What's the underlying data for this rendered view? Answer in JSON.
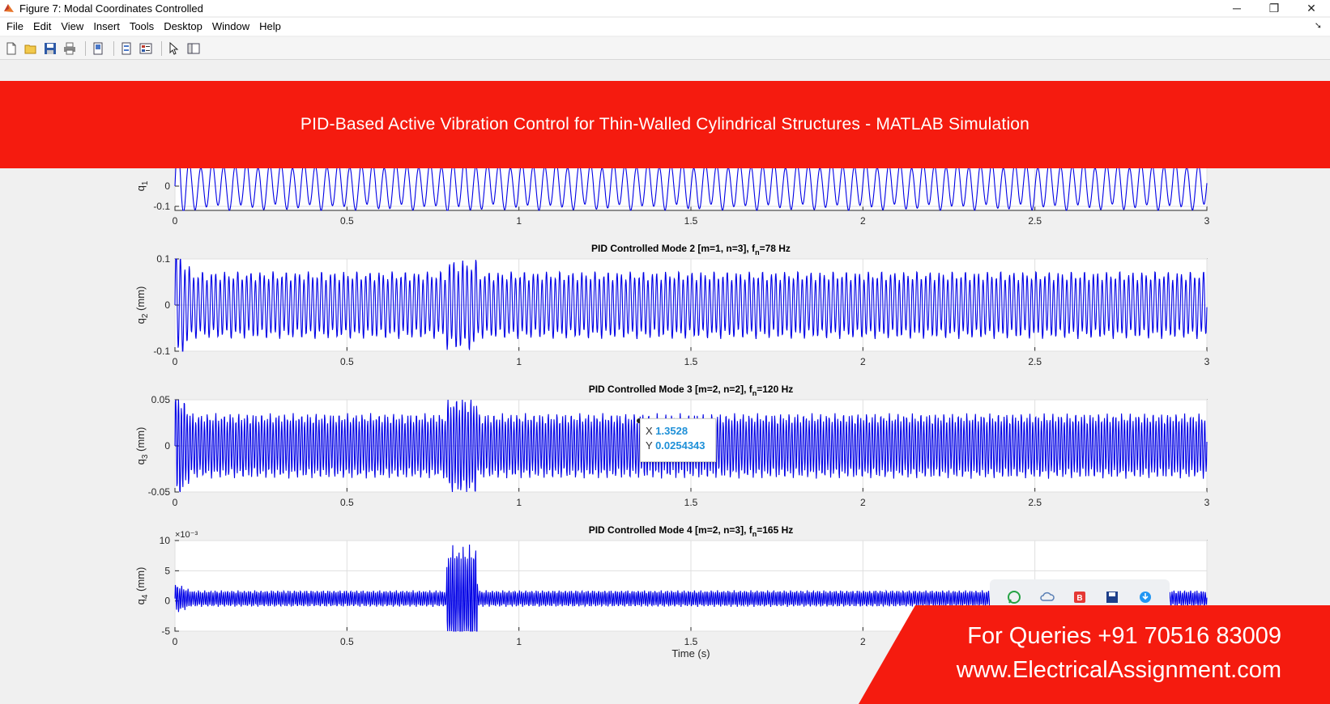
{
  "window": {
    "title": "Figure 7: Modal Coordinates Controlled"
  },
  "menu": {
    "items": [
      "File",
      "Edit",
      "View",
      "Insert",
      "Tools",
      "Desktop",
      "Window",
      "Help"
    ]
  },
  "toolbar": {
    "buttons": [
      "new-figure-icon",
      "open-file-icon",
      "save-icon",
      "print-icon",
      "dock-icon",
      "link-plot-icon",
      "insert-legend-icon",
      "edit-plot-icon",
      "property-editor-icon"
    ]
  },
  "banner": {
    "text": "PID-Based Active Vibration Control for Thin-Walled Cylindrical Structures - MATLAB Simulation"
  },
  "cta": {
    "line1": "For Queries +91 70516 83009",
    "line2": "www.ElectricalAssignment.com"
  },
  "share": {
    "icons": [
      "whatsapp-icon",
      "cloud-icon",
      "bookmark-icon",
      "save-disk-icon",
      "download-icon"
    ]
  },
  "datatip": {
    "x_label": "X",
    "x_value": "1.3528",
    "y_label": "Y",
    "y_value": "0.0254343"
  },
  "colors": {
    "banner": "#f51b0f",
    "trace": "#0000e6",
    "datatip_value": "#1e90d8"
  },
  "chart_data": [
    {
      "type": "line",
      "title": "",
      "xlabel": "",
      "ylabel_base": "q",
      "ylabel_sub": "1",
      "ylabel_unit": "",
      "xlim": [
        0,
        3
      ],
      "ylim": [
        -0.12,
        0.12
      ],
      "yticks": [
        {
          "v": 0,
          "label": "0"
        },
        {
          "v": -0.1,
          "label": "-0.1"
        }
      ],
      "xticks": [
        "0",
        "0.5",
        "1",
        "1.5",
        "2",
        "2.5",
        "3"
      ],
      "exponent": "",
      "signal": {
        "amplitude": 0.105,
        "cycles_per_unit": 30,
        "disturbance_at": 0.82,
        "disturbance_scale": 1.1
      }
    },
    {
      "type": "line",
      "title_main": "PID Controlled Mode 2   [m=1, n=3],  f",
      "title_sub": "n",
      "title_tail": "=78 Hz",
      "xlabel": "",
      "ylabel_base": "q",
      "ylabel_sub": "2",
      "ylabel_unit": " (mm)",
      "xlim": [
        0,
        3
      ],
      "ylim": [
        -0.1,
        0.1
      ],
      "yticks": [
        {
          "v": 0.1,
          "label": "0.1"
        },
        {
          "v": 0,
          "label": "0"
        },
        {
          "v": -0.1,
          "label": "-0.1"
        }
      ],
      "xticks": [
        "0",
        "0.5",
        "1",
        "1.5",
        "2",
        "2.5",
        "3"
      ],
      "exponent": "",
      "signal": {
        "amplitude": 0.064,
        "cycles_per_unit": 78,
        "disturbance_at": 0.82,
        "disturbance_scale": 1.35
      }
    },
    {
      "type": "line",
      "title_main": "PID Controlled Mode 3   [m=2, n=2],  f",
      "title_sub": "n",
      "title_tail": "=120 Hz",
      "xlabel": "",
      "ylabel_base": "q",
      "ylabel_sub": "3",
      "ylabel_unit": " (mm)",
      "xlim": [
        0,
        3
      ],
      "ylim": [
        -0.05,
        0.05
      ],
      "yticks": [
        {
          "v": 0.05,
          "label": "0.05"
        },
        {
          "v": 0,
          "label": "0"
        },
        {
          "v": -0.05,
          "label": "-0.05"
        }
      ],
      "xticks": [
        "0",
        "0.5",
        "1",
        "1.5",
        "2",
        "2.5",
        "3"
      ],
      "exponent": "",
      "signal": {
        "amplitude": 0.031,
        "cycles_per_unit": 120,
        "disturbance_at": 0.82,
        "disturbance_scale": 1.5
      }
    },
    {
      "type": "line",
      "title_main": "PID Controlled Mode 4   [m=2, n=3],  f",
      "title_sub": "n",
      "title_tail": "=165 Hz",
      "xlabel": "Time (s)",
      "ylabel_base": "q",
      "ylabel_sub": "4",
      "ylabel_unit": " (mm)",
      "xlim": [
        0,
        3
      ],
      "ylim": [
        -5,
        10
      ],
      "yticks": [
        {
          "v": 10,
          "label": "10"
        },
        {
          "v": 5,
          "label": "5"
        },
        {
          "v": 0,
          "label": "0"
        },
        {
          "v": -5,
          "label": "-5"
        }
      ],
      "xticks": [
        "0",
        "0.5",
        "1",
        "1.5",
        "2",
        "2.5",
        "3"
      ],
      "exponent": "×10⁻³",
      "signal": {
        "amplitude": 1.2,
        "cycles_per_unit": 165,
        "disturbance_at": 0.82,
        "disturbance_scale": 6.5
      }
    }
  ]
}
